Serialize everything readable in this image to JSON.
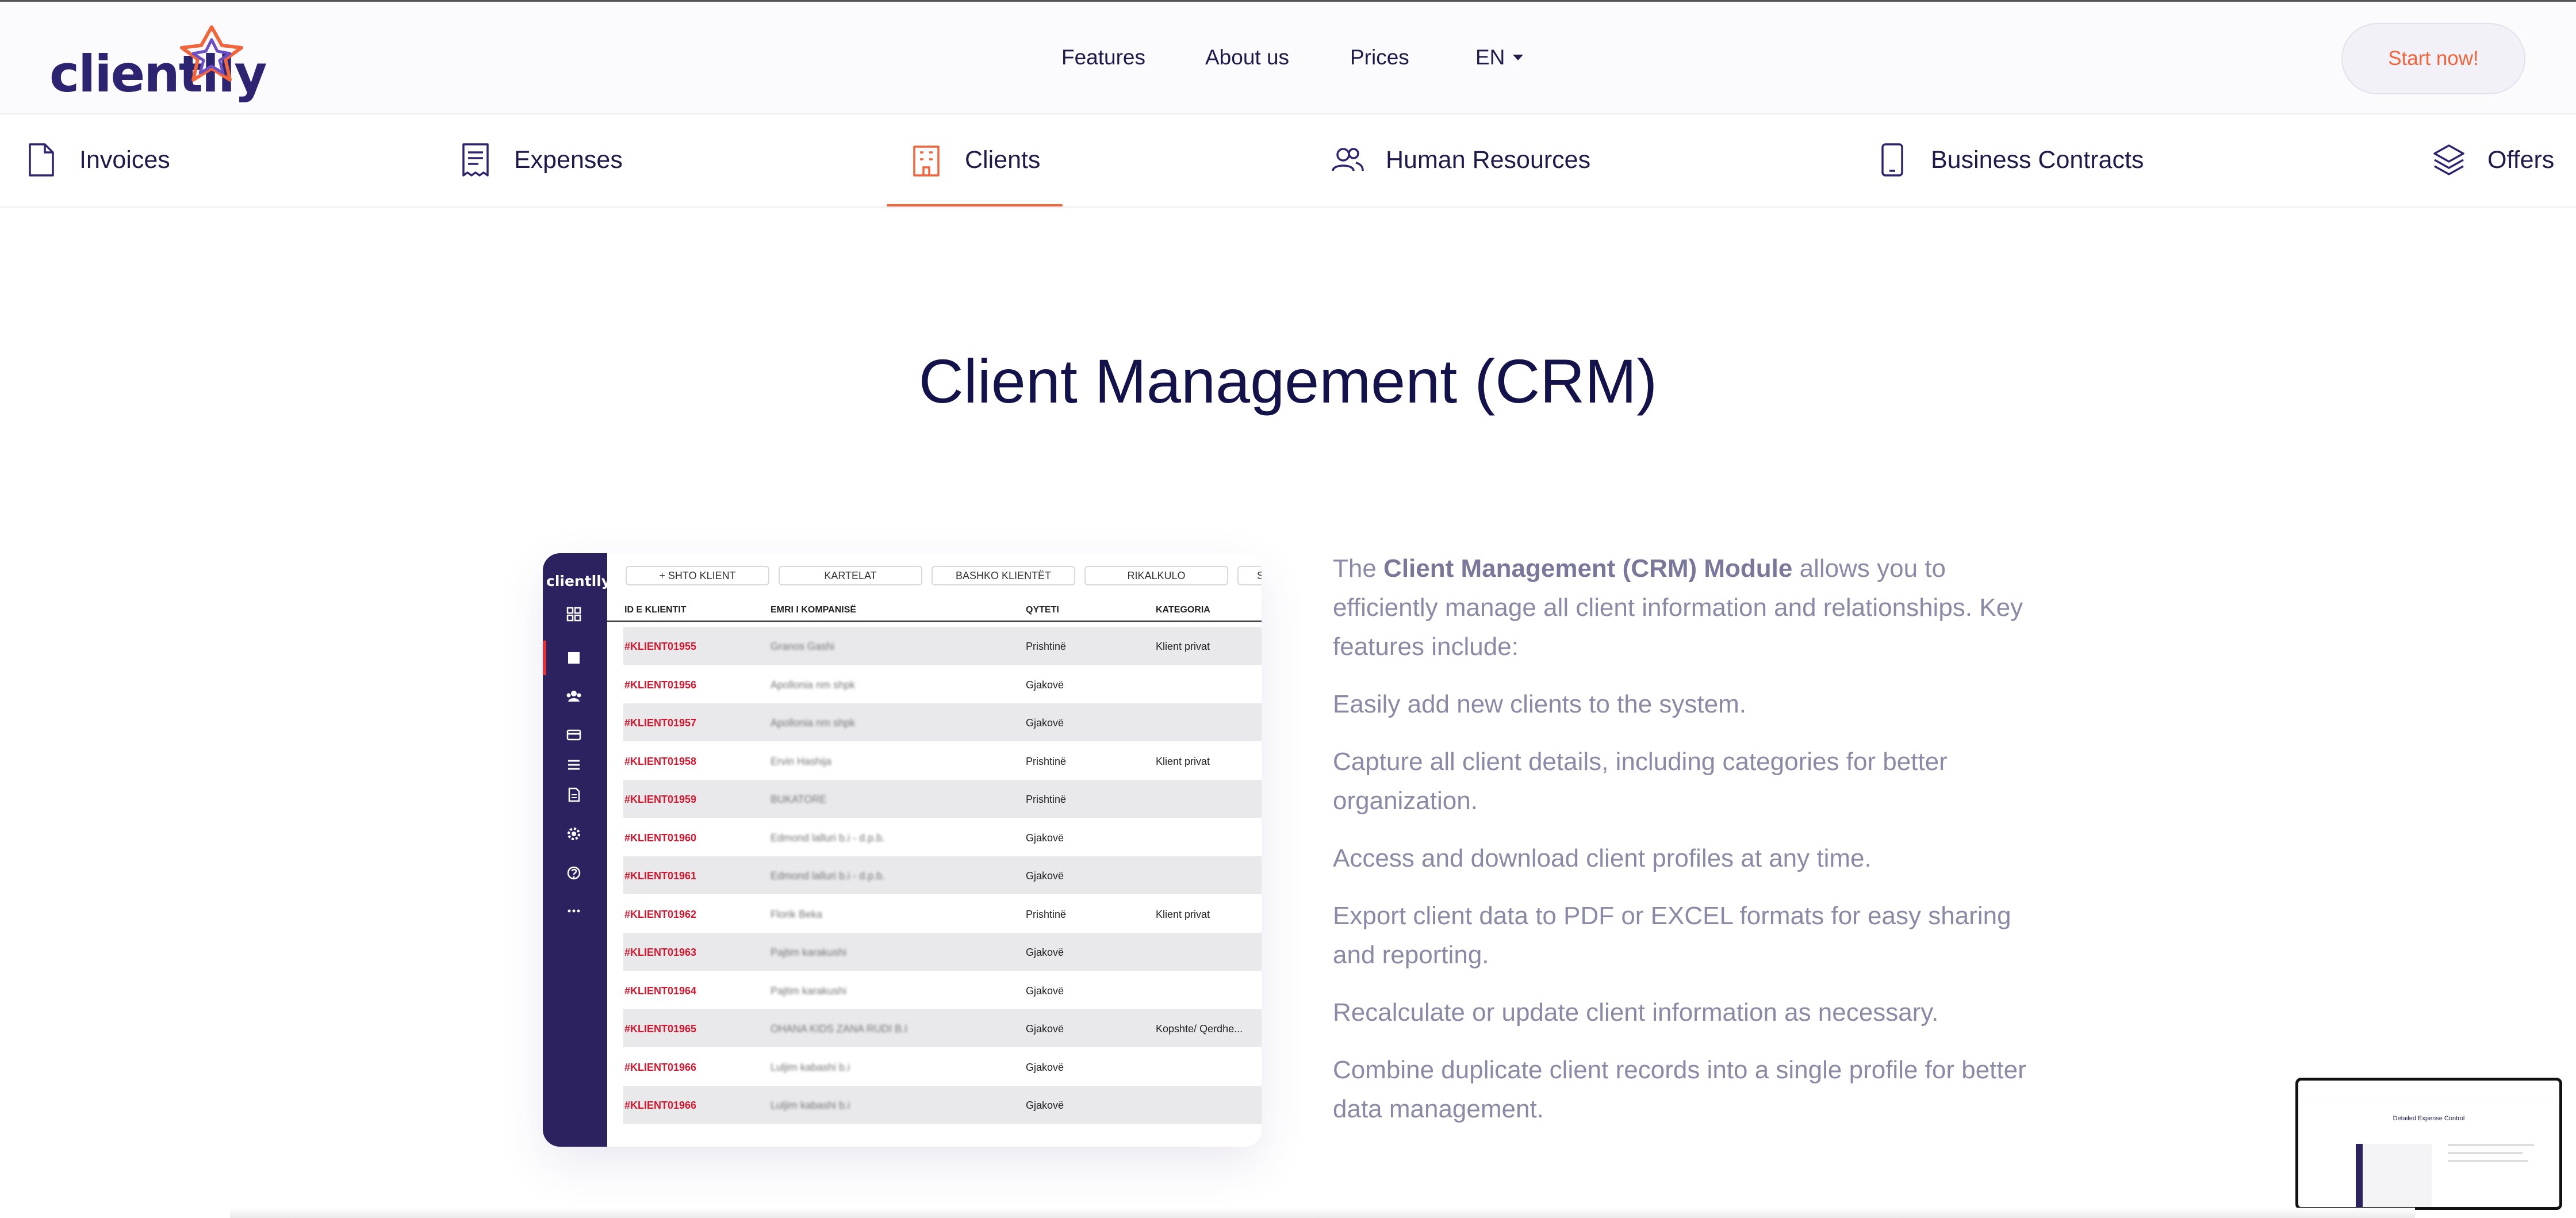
{
  "header": {
    "logo_text": "clientlly",
    "nav": [
      {
        "label": "Features"
      },
      {
        "label": "About us"
      },
      {
        "label": "Prices"
      }
    ],
    "language": "EN",
    "cta_label": "Start now!"
  },
  "tabs": [
    {
      "label": "Invoices",
      "icon": "document-icon"
    },
    {
      "label": "Expenses",
      "icon": "receipt-icon"
    },
    {
      "label": "Clients",
      "icon": "building-icon",
      "active": true
    },
    {
      "label": "Human Resources",
      "icon": "users-icon"
    },
    {
      "label": "Business Contracts",
      "icon": "tablet-icon"
    },
    {
      "label": "Offers",
      "icon": "layers-icon"
    }
  ],
  "section": {
    "title": "Client Management (CRM)"
  },
  "mock": {
    "logo_text": "clientlly",
    "buttons": [
      "+ SHTO KLIENT",
      "KARTELAT",
      "BASHKO KLIENTËT",
      "RIKALKULO",
      "S"
    ],
    "columns": [
      "ID E KLIENTIT",
      "EMRI I KOMPANISË",
      "QYTETI",
      "KATEGORIA"
    ],
    "rows": [
      {
        "id": "#KLIENT01955",
        "name": "Granos Gashi",
        "city": "Prishtinë",
        "category": "Klient privat"
      },
      {
        "id": "#KLIENT01956",
        "name": "Apollonia nm shpk",
        "city": "Gjakovë",
        "category": ""
      },
      {
        "id": "#KLIENT01957",
        "name": "Apollonia nm shpk",
        "city": "Gjakovë",
        "category": ""
      },
      {
        "id": "#KLIENT01958",
        "name": "Ervin Hashija",
        "city": "Prishtinë",
        "category": "Klient privat"
      },
      {
        "id": "#KLIENT01959",
        "name": "BUKATORE",
        "city": "Prishtinë",
        "category": ""
      },
      {
        "id": "#KLIENT01960",
        "name": "Edmond lalluri b.i - d.p.b.",
        "city": "Gjakovë",
        "category": ""
      },
      {
        "id": "#KLIENT01961",
        "name": "Edmond lalluri b.i - d.p.b.",
        "city": "Gjakovë",
        "category": ""
      },
      {
        "id": "#KLIENT01962",
        "name": "Florik Beka",
        "city": "Prishtinë",
        "category": "Klient privat"
      },
      {
        "id": "#KLIENT01963",
        "name": "Pajtim karakushi",
        "city": "Gjakovë",
        "category": ""
      },
      {
        "id": "#KLIENT01964",
        "name": "Pajtim karakushi",
        "city": "Gjakovë",
        "category": ""
      },
      {
        "id": "#KLIENT01965",
        "name": "OHANA KIDS ZANA RUDI B.I",
        "city": "Gjakovë",
        "category": "Kopshte/ Qerdhe..."
      },
      {
        "id": "#KLIENT01966",
        "name": "Luljim kabashi b.i",
        "city": "Gjakovë",
        "category": ""
      },
      {
        "id": "#KLIENT01966",
        "name": "Luljim kabashi b.i",
        "city": "Gjakovë",
        "category": ""
      }
    ]
  },
  "description": {
    "intro_prefix": "The ",
    "intro_bold": "Client Management (CRM) Module",
    "intro_suffix": " allows you to efficiently manage all client information and relationships. Key features include:",
    "features": [
      "Easily add new clients to the system.",
      "Capture all client details, including categories for better organization.",
      "Access and download client profiles at any time.",
      "Export client data to PDF or EXCEL formats for easy sharing and reporting.",
      "Recalculate or update client information as necessary.",
      "Combine duplicate client records into a single profile for better data management."
    ]
  },
  "preview_thumb": {
    "title": "Detailed Expense Control"
  },
  "colors": {
    "accent": "#f2643a",
    "brand": "#2c2470",
    "sidebar": "#2c2260",
    "id_red": "#d3162d"
  }
}
